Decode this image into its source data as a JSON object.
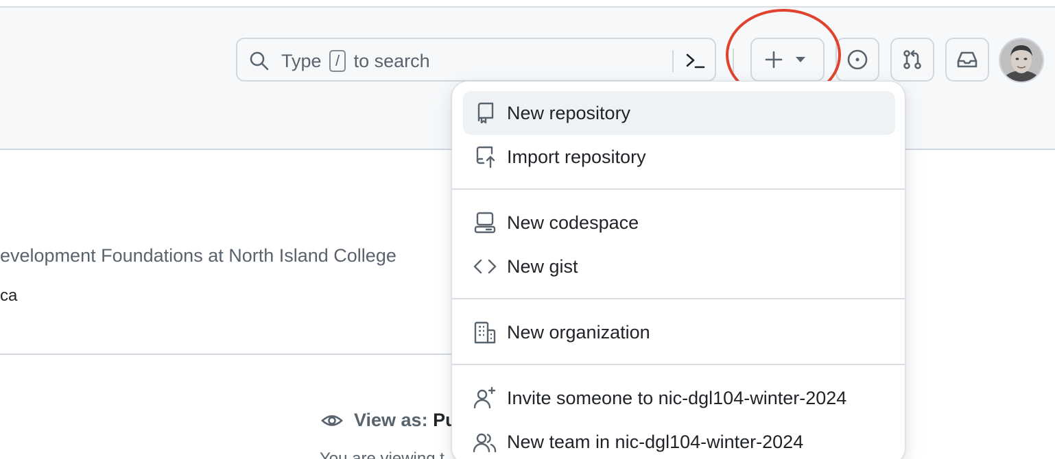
{
  "header": {
    "search": {
      "text_before": "Type",
      "shortcut_key": "/",
      "text_after": "to search"
    }
  },
  "profile": {
    "bio": "evelopment Foundations at North Island College",
    "email": "ca",
    "view_as_label": "View as:",
    "view_as_value": "Pu",
    "viewing_text": "You are viewing t"
  },
  "menu": {
    "items": [
      {
        "label": "New repository",
        "icon": "repo-icon"
      },
      {
        "label": "Import repository",
        "icon": "repo-push-icon"
      },
      {
        "label": "New codespace",
        "icon": "codespaces-icon"
      },
      {
        "label": "New gist",
        "icon": "code-icon"
      },
      {
        "label": "New organization",
        "icon": "organization-icon"
      },
      {
        "label": "Invite someone to nic-dgl104-winter-2024",
        "icon": "person-add-icon"
      },
      {
        "label": "New team in nic-dgl104-winter-2024",
        "icon": "people-icon"
      }
    ]
  },
  "colors": {
    "annotation": "#e0422d",
    "header_bg": "#f6f8fa",
    "border": "#d0d7de",
    "muted_text": "#59636e",
    "active_item_bg": "#eff2f5"
  }
}
